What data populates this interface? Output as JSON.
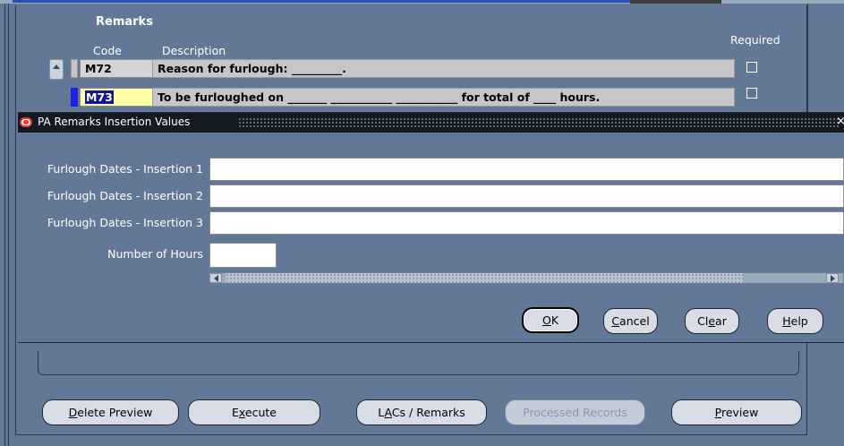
{
  "remarks": {
    "title": "Remarks",
    "code_header": "Code",
    "description_header": "Description",
    "required_header": "Required",
    "rows": [
      {
        "code": "M72",
        "description": "Reason for furlough: _________.",
        "required": false,
        "selected": false
      },
      {
        "code": "M73",
        "description": "To be furloughed on _______ ___________ ___________ for total of ____ hours.",
        "required": false,
        "selected": true
      }
    ]
  },
  "dialog": {
    "title": "PA Remarks Insertion Values",
    "close_glyph": "×",
    "fields": [
      {
        "label": "Furlough Dates - Insertion 1",
        "value": ""
      },
      {
        "label": "Furlough Dates - Insertion 2",
        "value": ""
      },
      {
        "label": "Furlough Dates - Insertion 3",
        "value": ""
      },
      {
        "label": "Number of Hours",
        "value": ""
      }
    ],
    "buttons": {
      "ok": {
        "mnemonic": "O",
        "rest": "K"
      },
      "cancel": {
        "mnemonic": "C",
        "rest": "ancel"
      },
      "clear": {
        "pre": "Cl",
        "mnemonic": "e",
        "rest": "ar"
      },
      "help": {
        "mnemonic": "H",
        "rest": "elp"
      }
    }
  },
  "bottom_buttons": {
    "delete_preview": {
      "mnemonic": "D",
      "rest": "elete Preview"
    },
    "execute": {
      "pre": "E",
      "mnemonic": "x",
      "rest": "ecute"
    },
    "lacs_remarks": {
      "pre": "L",
      "mnemonic": "A",
      "rest": "Cs / Remarks"
    },
    "processed_records": "Processed Records",
    "preview": {
      "mnemonic": "P",
      "rest": "review"
    }
  },
  "colors": {
    "background": "#627896",
    "title_bar": "#141a24",
    "selected_field": "#ffffa5",
    "row_marker_active": "#1d21e6"
  }
}
